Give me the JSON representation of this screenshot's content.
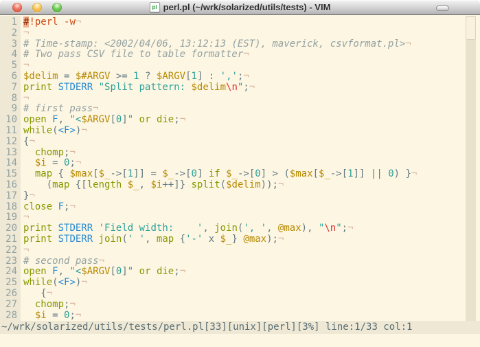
{
  "window": {
    "title": "perl.pl (~/wrk/solarized/utils/tests) - VIM",
    "doc_icon_label": "pl"
  },
  "colors": {
    "editor_bg": "#fdf6e3",
    "gutter_bg": "#eee8d5",
    "statusbar_bg": "#eee8d5",
    "text_base": "#657b83",
    "keyword_green": "#859900",
    "variable_yellow": "#b58900",
    "string_cyan": "#2aa198",
    "filehandle_blue": "#268bd2",
    "escape_red": "#dc322f",
    "comment_gray": "#93a1a1",
    "shebang_orange": "#cb4b16",
    "cursor_bg": "#f0b28e",
    "eol_marker": "#d9b8a1",
    "traffic_red": "#d8503c",
    "traffic_yellow": "#e8a83a",
    "traffic_green": "#4fb03a"
  },
  "editor": {
    "eol_char": "¬",
    "lines": [
      {
        "num": 1,
        "tokens": [
          [
            "cursor",
            "#"
          ],
          [
            "sheb",
            "!perl -w"
          ]
        ]
      },
      {
        "num": 2,
        "tokens": []
      },
      {
        "num": 3,
        "tokens": [
          [
            "cmt",
            "# Time-stamp: <2002/04/06, 13:12:13 (EST), maverick, csvformat.pl>"
          ]
        ]
      },
      {
        "num": 4,
        "tokens": [
          [
            "cmt",
            "# Two pass CSV file to table formatter"
          ]
        ]
      },
      {
        "num": 5,
        "tokens": []
      },
      {
        "num": 6,
        "tokens": [
          [
            "var",
            "$delim"
          ],
          [
            "plain",
            " = "
          ],
          [
            "var",
            "$#ARGV"
          ],
          [
            "plain",
            " >= "
          ],
          [
            "str",
            "1"
          ],
          [
            "plain",
            " ? "
          ],
          [
            "var",
            "$ARGV"
          ],
          [
            "plain",
            "["
          ],
          [
            "str",
            "1"
          ],
          [
            "plain",
            "] : "
          ],
          [
            "str",
            "','"
          ],
          [
            "plain",
            ";"
          ]
        ]
      },
      {
        "num": 7,
        "tokens": [
          [
            "kw",
            "print"
          ],
          [
            "plain",
            " "
          ],
          [
            "io",
            "STDERR"
          ],
          [
            "plain",
            " "
          ],
          [
            "str",
            "\"Split pattern: "
          ],
          [
            "var",
            "$delim"
          ],
          [
            "esc",
            "\\n"
          ],
          [
            "str",
            "\""
          ],
          [
            "plain",
            ";"
          ]
        ]
      },
      {
        "num": 8,
        "tokens": []
      },
      {
        "num": 9,
        "tokens": [
          [
            "cmt",
            "# first pass"
          ]
        ]
      },
      {
        "num": 10,
        "tokens": [
          [
            "kw",
            "open"
          ],
          [
            "plain",
            " "
          ],
          [
            "io",
            "F"
          ],
          [
            "plain",
            ", "
          ],
          [
            "str",
            "\"<"
          ],
          [
            "var",
            "$ARGV"
          ],
          [
            "plain",
            "["
          ],
          [
            "str",
            "0"
          ],
          [
            "plain",
            "]"
          ],
          [
            "str",
            "\""
          ],
          [
            "plain",
            " "
          ],
          [
            "kw",
            "or"
          ],
          [
            "plain",
            " "
          ],
          [
            "kw",
            "die"
          ],
          [
            "plain",
            ";"
          ]
        ]
      },
      {
        "num": 11,
        "tokens": [
          [
            "kw",
            "while"
          ],
          [
            "plain",
            "("
          ],
          [
            "io",
            "<F>"
          ],
          [
            "plain",
            ")"
          ]
        ]
      },
      {
        "num": 12,
        "tokens": [
          [
            "plain",
            "{"
          ]
        ]
      },
      {
        "num": 13,
        "tokens": [
          [
            "plain",
            "  "
          ],
          [
            "kw",
            "chomp"
          ],
          [
            "plain",
            ";"
          ]
        ]
      },
      {
        "num": 14,
        "tokens": [
          [
            "plain",
            "  "
          ],
          [
            "var",
            "$i"
          ],
          [
            "plain",
            " = "
          ],
          [
            "str",
            "0"
          ],
          [
            "plain",
            ";"
          ]
        ]
      },
      {
        "num": 15,
        "tokens": [
          [
            "plain",
            "  "
          ],
          [
            "kw",
            "map"
          ],
          [
            "plain",
            " { "
          ],
          [
            "var",
            "$max"
          ],
          [
            "plain",
            "["
          ],
          [
            "var",
            "$_"
          ],
          [
            "plain",
            "->["
          ],
          [
            "str",
            "1"
          ],
          [
            "plain",
            "]] = "
          ],
          [
            "var",
            "$_"
          ],
          [
            "plain",
            "->["
          ],
          [
            "str",
            "0"
          ],
          [
            "plain",
            "] "
          ],
          [
            "kw",
            "if"
          ],
          [
            "plain",
            " "
          ],
          [
            "var",
            "$_"
          ],
          [
            "plain",
            "->["
          ],
          [
            "str",
            "0"
          ],
          [
            "plain",
            "] > ("
          ],
          [
            "var",
            "$max"
          ],
          [
            "plain",
            "["
          ],
          [
            "var",
            "$_"
          ],
          [
            "plain",
            "->["
          ],
          [
            "str",
            "1"
          ],
          [
            "plain",
            "]] || "
          ],
          [
            "str",
            "0"
          ],
          [
            "plain",
            ") }"
          ]
        ]
      },
      {
        "num": 16,
        "tokens": [
          [
            "plain",
            "    ("
          ],
          [
            "kw",
            "map"
          ],
          [
            "plain",
            " {["
          ],
          [
            "kw",
            "length"
          ],
          [
            "plain",
            " "
          ],
          [
            "var",
            "$_"
          ],
          [
            "plain",
            ", "
          ],
          [
            "var",
            "$i"
          ],
          [
            "plain",
            "++]} "
          ],
          [
            "kw",
            "split"
          ],
          [
            "plain",
            "("
          ],
          [
            "var",
            "$delim"
          ],
          [
            "plain",
            "));"
          ]
        ]
      },
      {
        "num": 17,
        "tokens": [
          [
            "plain",
            "}"
          ]
        ]
      },
      {
        "num": 18,
        "tokens": [
          [
            "kw",
            "close"
          ],
          [
            "plain",
            " "
          ],
          [
            "io",
            "F"
          ],
          [
            "plain",
            ";"
          ]
        ]
      },
      {
        "num": 19,
        "tokens": []
      },
      {
        "num": 20,
        "tokens": [
          [
            "kw",
            "print"
          ],
          [
            "plain",
            " "
          ],
          [
            "io",
            "STDERR"
          ],
          [
            "plain",
            " "
          ],
          [
            "str",
            "'Field width:    '"
          ],
          [
            "plain",
            ", "
          ],
          [
            "kw",
            "join"
          ],
          [
            "plain",
            "("
          ],
          [
            "str",
            "', '"
          ],
          [
            "plain",
            ", "
          ],
          [
            "var",
            "@max"
          ],
          [
            "plain",
            "), "
          ],
          [
            "str",
            "\""
          ],
          [
            "esc",
            "\\n"
          ],
          [
            "str",
            "\""
          ],
          [
            "plain",
            ";"
          ]
        ]
      },
      {
        "num": 21,
        "tokens": [
          [
            "kw",
            "print"
          ],
          [
            "plain",
            " "
          ],
          [
            "io",
            "STDERR"
          ],
          [
            "plain",
            " "
          ],
          [
            "kw",
            "join"
          ],
          [
            "plain",
            "("
          ],
          [
            "str",
            "' '"
          ],
          [
            "plain",
            ", "
          ],
          [
            "kw",
            "map"
          ],
          [
            "plain",
            " {"
          ],
          [
            "str",
            "'-'"
          ],
          [
            "plain",
            " x "
          ],
          [
            "var",
            "$_"
          ],
          [
            "plain",
            "} "
          ],
          [
            "var",
            "@max"
          ],
          [
            "plain",
            ");"
          ]
        ]
      },
      {
        "num": 22,
        "tokens": []
      },
      {
        "num": 23,
        "tokens": [
          [
            "cmt",
            "# second pass"
          ]
        ]
      },
      {
        "num": 24,
        "tokens": [
          [
            "kw",
            "open"
          ],
          [
            "plain",
            " "
          ],
          [
            "io",
            "F"
          ],
          [
            "plain",
            ", "
          ],
          [
            "str",
            "\"<"
          ],
          [
            "var",
            "$ARGV"
          ],
          [
            "plain",
            "["
          ],
          [
            "str",
            "0"
          ],
          [
            "plain",
            "]"
          ],
          [
            "str",
            "\""
          ],
          [
            "plain",
            " "
          ],
          [
            "kw",
            "or"
          ],
          [
            "plain",
            " "
          ],
          [
            "kw",
            "die"
          ],
          [
            "plain",
            ";"
          ]
        ]
      },
      {
        "num": 25,
        "tokens": [
          [
            "kw",
            "while"
          ],
          [
            "plain",
            "("
          ],
          [
            "io",
            "<F>"
          ],
          [
            "plain",
            ")"
          ]
        ]
      },
      {
        "num": 26,
        "tokens": [
          [
            "plain",
            "   {"
          ]
        ]
      },
      {
        "num": 27,
        "tokens": [
          [
            "plain",
            "  "
          ],
          [
            "kw",
            "chomp"
          ],
          [
            "plain",
            ";"
          ]
        ]
      },
      {
        "num": 28,
        "tokens": [
          [
            "plain",
            "  "
          ],
          [
            "var",
            "$i"
          ],
          [
            "plain",
            " = "
          ],
          [
            "str",
            "0"
          ],
          [
            "plain",
            ";"
          ]
        ]
      }
    ]
  },
  "status_bar": {
    "text": "~/wrk/solarized/utils/tests/perl.pl[33][unix][perl][3%] line:1/33 col:1"
  }
}
